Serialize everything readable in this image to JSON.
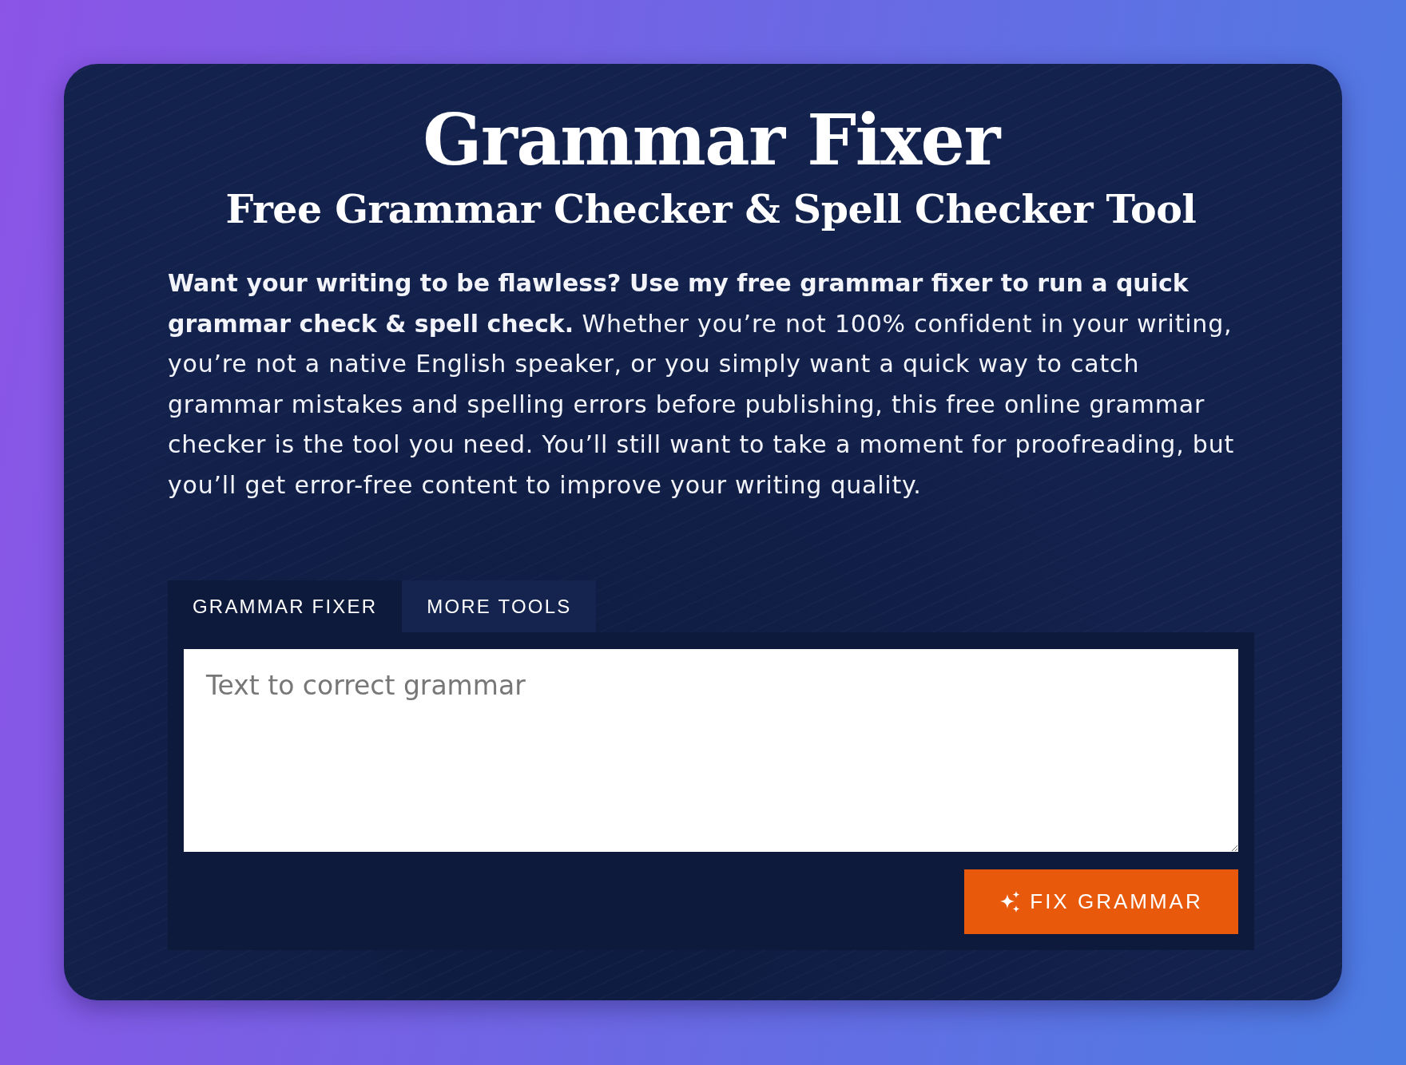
{
  "header": {
    "title": "Grammar Fixer",
    "subtitle": "Free Grammar Checker & Spell Checker Tool"
  },
  "intro": "**Want your writing to be flawless? Use my free grammar fixer to run a quick grammar check & spell check.** Whether you’re not 100% confident in your writing, you’re not a native English speaker, or you simply want a quick way to catch grammar mistakes and spelling errors before publishing, this free online grammar checker is the tool you need. You’ll still want to take a moment for proofreading, but you’ll get error-free content to improve your writing quality.",
  "tabs": [
    {
      "label": "GRAMMAR FIXER",
      "selected": true
    },
    {
      "label": "MORE TOOLS",
      "selected": false
    }
  ],
  "editor": {
    "placeholder": "Text to correct grammar"
  },
  "fix_button": {
    "label": "FIX GRAMMAR"
  }
}
